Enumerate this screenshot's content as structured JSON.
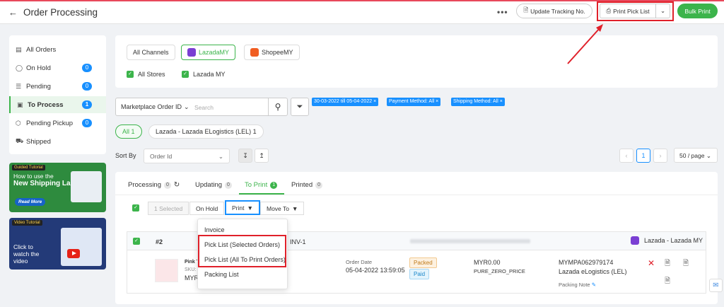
{
  "header": {
    "title": "Order Processing",
    "update_tracking": "Update Tracking No.",
    "print_pick_list": "Print Pick List",
    "bulk_print": "Bulk Print"
  },
  "sidebar": {
    "items": [
      {
        "label": "All Orders",
        "count": ""
      },
      {
        "label": "On Hold",
        "count": "0"
      },
      {
        "label": "Pending",
        "count": "0"
      },
      {
        "label": "To Process",
        "count": "1"
      },
      {
        "label": "Pending Pickup",
        "count": "0"
      },
      {
        "label": "Shipped",
        "count": ""
      }
    ]
  },
  "promos": {
    "guided_tag": "Guided Tutorial",
    "guided_line1": "How to use the",
    "guided_line2": "New Shipping Label?",
    "read_more": "Read More",
    "video_tag": "Video Tutorial",
    "video_text": "Click to watch the video"
  },
  "channels": {
    "all": "All Channels",
    "lazada": "LazadaMY",
    "shopee": "ShopeeMY",
    "all_stores": "All Stores",
    "lazada_store": "Lazada MY"
  },
  "search": {
    "field": "Marketplace Order ID",
    "placeholder": "Search"
  },
  "filters": {
    "date": "30-03-2022 till 05-04-2022",
    "payment": "Payment Method: All",
    "shipping": "Shipping Method: All"
  },
  "logistics": {
    "all": "All 1",
    "lel": "Lazada - Lazada ELogistics (LEL) 1"
  },
  "sort": {
    "label": "Sort By",
    "value": "Order Id"
  },
  "pager": {
    "current": "1",
    "per_page": "50 / page"
  },
  "tabs": [
    {
      "label": "Processing",
      "count": "0"
    },
    {
      "label": "Updating",
      "count": "0"
    },
    {
      "label": "To Print",
      "count": "1"
    },
    {
      "label": "Printed",
      "count": "0"
    }
  ],
  "actions": {
    "selected": "1 Selected",
    "on_hold": "On Hold",
    "print": "Print",
    "move_to": "Move To"
  },
  "print_menu": {
    "invoice": "Invoice",
    "pick_selected": "Pick List (Selected Orders)",
    "pick_all": "Pick List (All To Print Orders)",
    "packing": "Packing List"
  },
  "order": {
    "number": "#2",
    "inv": "INV-1",
    "channel": "Lazada - Lazada MY",
    "product": "Pink T",
    "sku": "SKU:",
    "price_short": "MYR",
    "date_label": "Order Date",
    "date": "05-04-2022 13:59:05",
    "status_packed": "Packed",
    "status_paid": "Paid",
    "amount": "MYR0.00",
    "pricing": "PURE_ZERO_PRICE",
    "tracking": "MYMPA062979174",
    "logistics": "Lazada eLogistics (LEL)",
    "packing_note": "Packing Note"
  },
  "colors": {
    "accent": "#3cb44b",
    "blue": "#1890ff",
    "highlight": "#e0202a"
  }
}
